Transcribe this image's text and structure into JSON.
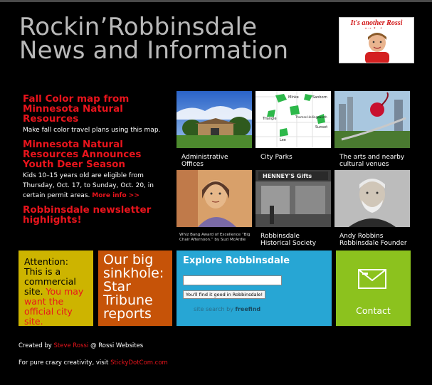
{
  "header": {
    "title_line1": "Rockin’Robbinsdale",
    "title_line2": "News and Information",
    "badge_text": "It's another Rossi Website."
  },
  "news": [
    {
      "headline": "Fall Color map from Minnesota Natural Resources",
      "body": "Make fall color travel plans using this map."
    },
    {
      "headline": "Minnesota Natural Resources Announces Youth Deer Season",
      "body": "Kids 10–15 years old are eligible from Thursday, Oct. 17, to Sunday, Oct. 20, in certain permit areas.",
      "link": "More info >>"
    },
    {
      "headline": "Robbinsdale newsletter highlights!"
    }
  ],
  "tiles": [
    {
      "caption": "Administrative Offices"
    },
    {
      "caption": "City Parks",
      "map_labels": [
        "Mlnke",
        "Sanborn",
        "Thomas Hollingsworth",
        "Triangle",
        "Sunset",
        "Lee"
      ]
    },
    {
      "caption": "The arts and nearby cultural venues"
    },
    {
      "caption": "Whiz Bang Award of Excellence “Big Chair Afternoon.” by Suzi McArdle"
    },
    {
      "caption": "Robbinsdale Historical Society",
      "sign_text": "HENNEY'S Gifts"
    },
    {
      "caption": "Andy Robbins Robbinsdale Founder"
    }
  ],
  "boxes": {
    "attention_text": "Attention: This is a commercial site.",
    "attention_red": "You may want the official city site.",
    "sinkhole_text": "Our big sinkhole: Star Tribune reports",
    "explore_title": "Explore Robbinsdale",
    "search_value": "",
    "search_button": "You'll find it good in Robbinsdale!",
    "powered_prefix": "site search",
    "powered_by": "by",
    "powered_brand": "freefind",
    "contact_label": "Contact"
  },
  "footer": {
    "created_prefix": "Created by",
    "created_name": "Steve Rossi",
    "created_suffix": "@ Rossi Websites",
    "creativity_prefix": "For pure crazy creativity, visit",
    "creativity_link": "StickyDotCom.com"
  },
  "colors": {
    "background": "#000000",
    "title_gray": "#b9b9b9",
    "accent_red": "#e8141c",
    "attention_yellow": "#cdb400",
    "sinkhole_orange": "#c65308",
    "explore_blue": "#27a6d4",
    "contact_green": "#8cc21e"
  },
  "icons": [
    "envelope-icon"
  ]
}
